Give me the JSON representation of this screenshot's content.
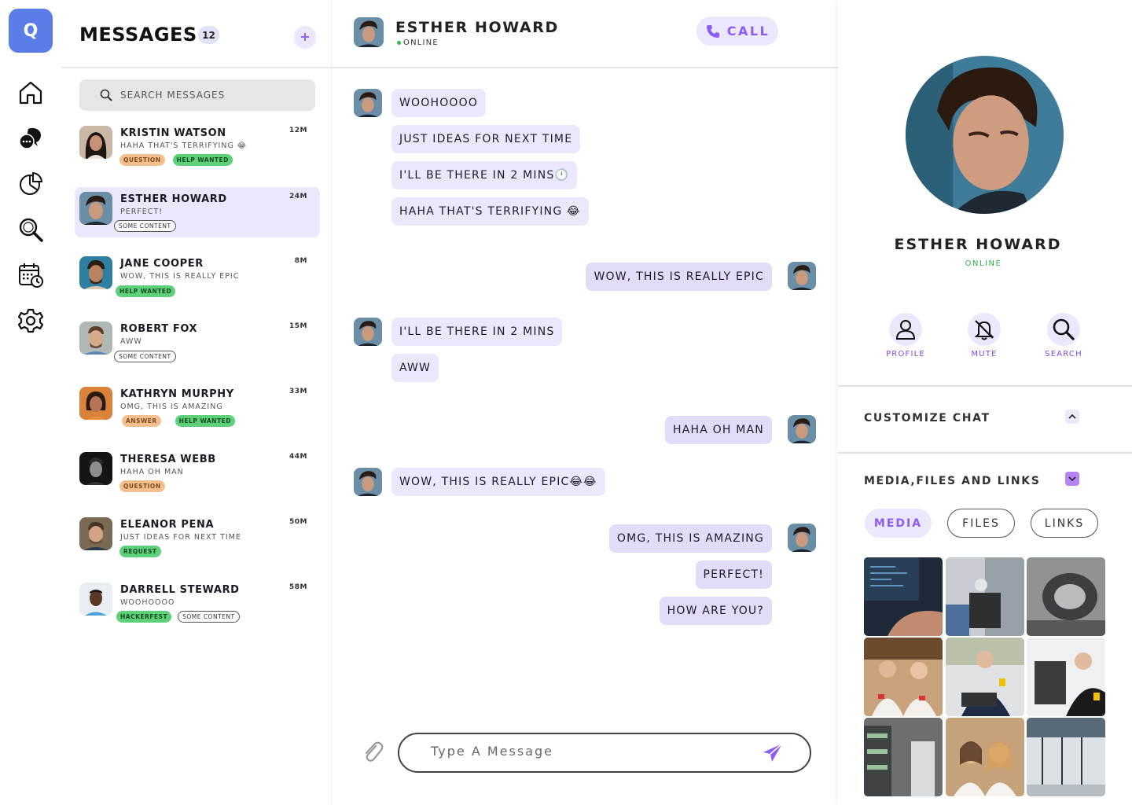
{
  "rail": {
    "logo_letter": "Q",
    "items": [
      {
        "icon": "home-icon"
      },
      {
        "icon": "chat-bubbles-icon"
      },
      {
        "icon": "pie-chart-icon"
      },
      {
        "icon": "search-icon"
      },
      {
        "icon": "calendar-icon"
      },
      {
        "icon": "gear-icon"
      }
    ]
  },
  "list": {
    "title": "MESSAGES",
    "count": "12",
    "new_label": "+",
    "search_placeholder": "SEARCH MESSAGES",
    "conversations": [
      {
        "name": "KRISTIN WATSON",
        "preview": "HAHA THAT'S TERRIFYING 😂",
        "time": "12M",
        "tags": [
          {
            "text": "QUESTION",
            "style": "orange"
          },
          {
            "text": "HELP WANTED",
            "style": "green"
          }
        ]
      },
      {
        "name": "ESTHER HOWARD",
        "preview": "PERFECT!",
        "time": "24M",
        "tags": [
          {
            "text": "SOME CONTENT",
            "style": "outline"
          }
        ]
      },
      {
        "name": "JANE COOPER",
        "preview": "WOW, THIS IS REALLY EPIC",
        "time": "8M",
        "tags": [
          {
            "text": "HELP WANTED",
            "style": "green"
          }
        ]
      },
      {
        "name": "ROBERT FOX",
        "preview": "AWW",
        "time": "15M",
        "tags": [
          {
            "text": "SOME CONTENT",
            "style": "outline"
          }
        ]
      },
      {
        "name": "KATHRYN MURPHY",
        "preview": "OMG, THIS IS AMAZING",
        "time": "33M",
        "tags": [
          {
            "text": "ANSWER",
            "style": "orange"
          },
          {
            "text": "HELP WANTED",
            "style": "green"
          }
        ]
      },
      {
        "name": "THERESA WEBB",
        "preview": "HAHA OH MAN",
        "time": "44M",
        "tags": [
          {
            "text": "QUESTION",
            "style": "orange"
          }
        ]
      },
      {
        "name": "ELEANOR PENA",
        "preview": "JUST IDEAS FOR NEXT TIME",
        "time": "50M",
        "tags": [
          {
            "text": "REQUEST",
            "style": "green"
          }
        ]
      },
      {
        "name": "DARRELL STEWARD",
        "preview": "WOOHOOOO",
        "time": "58M",
        "tags": [
          {
            "text": "HACKERFEST",
            "style": "green"
          },
          {
            "text": "SOME CONTENT",
            "style": "outline"
          }
        ]
      }
    ]
  },
  "chat": {
    "name": "ESTHER HOWARD",
    "status": "ONLINE",
    "call_label": "CALL",
    "messages": [
      {
        "text": "WOOHOOOO",
        "dir": "in"
      },
      {
        "text": "JUST IDEAS FOR NEXT TIME",
        "dir": "in"
      },
      {
        "text": "I'LL BE THERE IN 2 MINS🕛",
        "dir": "in"
      },
      {
        "text": "HAHA THAT'S TERRIFYING 😂",
        "dir": "in"
      },
      {
        "text": "WOW, THIS IS REALLY EPIC",
        "dir": "out"
      },
      {
        "text": "I'LL BE THERE IN 2 MINS",
        "dir": "in"
      },
      {
        "text": "AWW",
        "dir": "in"
      },
      {
        "text": "HAHA OH MAN",
        "dir": "out"
      },
      {
        "text": "WOW, THIS IS REALLY EPIC😂😂",
        "dir": "in"
      },
      {
        "text": "OMG, THIS IS AMAZING",
        "dir": "out"
      },
      {
        "text": "PERFECT!",
        "dir": "out"
      },
      {
        "text": "HOW ARE YOU?",
        "dir": "out"
      }
    ],
    "composer_placeholder": "Type A Message"
  },
  "profile": {
    "name": "ESTHER HOWARD",
    "status": "ONLINE",
    "actions": [
      {
        "label": "PROFILE",
        "icon": "user-icon"
      },
      {
        "label": "MUTE",
        "icon": "bell-off-icon"
      },
      {
        "label": "SEARCH",
        "icon": "search-icon"
      }
    ],
    "customize_title": "CUSTOMIZE CHAT",
    "media_title": "MEDIA,FILES AND LINKS",
    "media_tabs": [
      "MEDIA",
      "FILES",
      "LINKS"
    ],
    "active_tab": "MEDIA",
    "media_items": [
      "laptop-code-photo",
      "lab-equipment-photo",
      "machine-photo",
      "team-store-photo",
      "technician-laptop-photo",
      "worker-device-photo",
      "shelves-store-photo",
      "two-women-photo",
      "store-front-photo"
    ]
  },
  "colors": {
    "accent": "#8b5cf6",
    "bubble_in": "#ece8fb",
    "bubble_out": "#e3dcf8",
    "logo": "#5b7de8",
    "online": "#26c04f"
  }
}
